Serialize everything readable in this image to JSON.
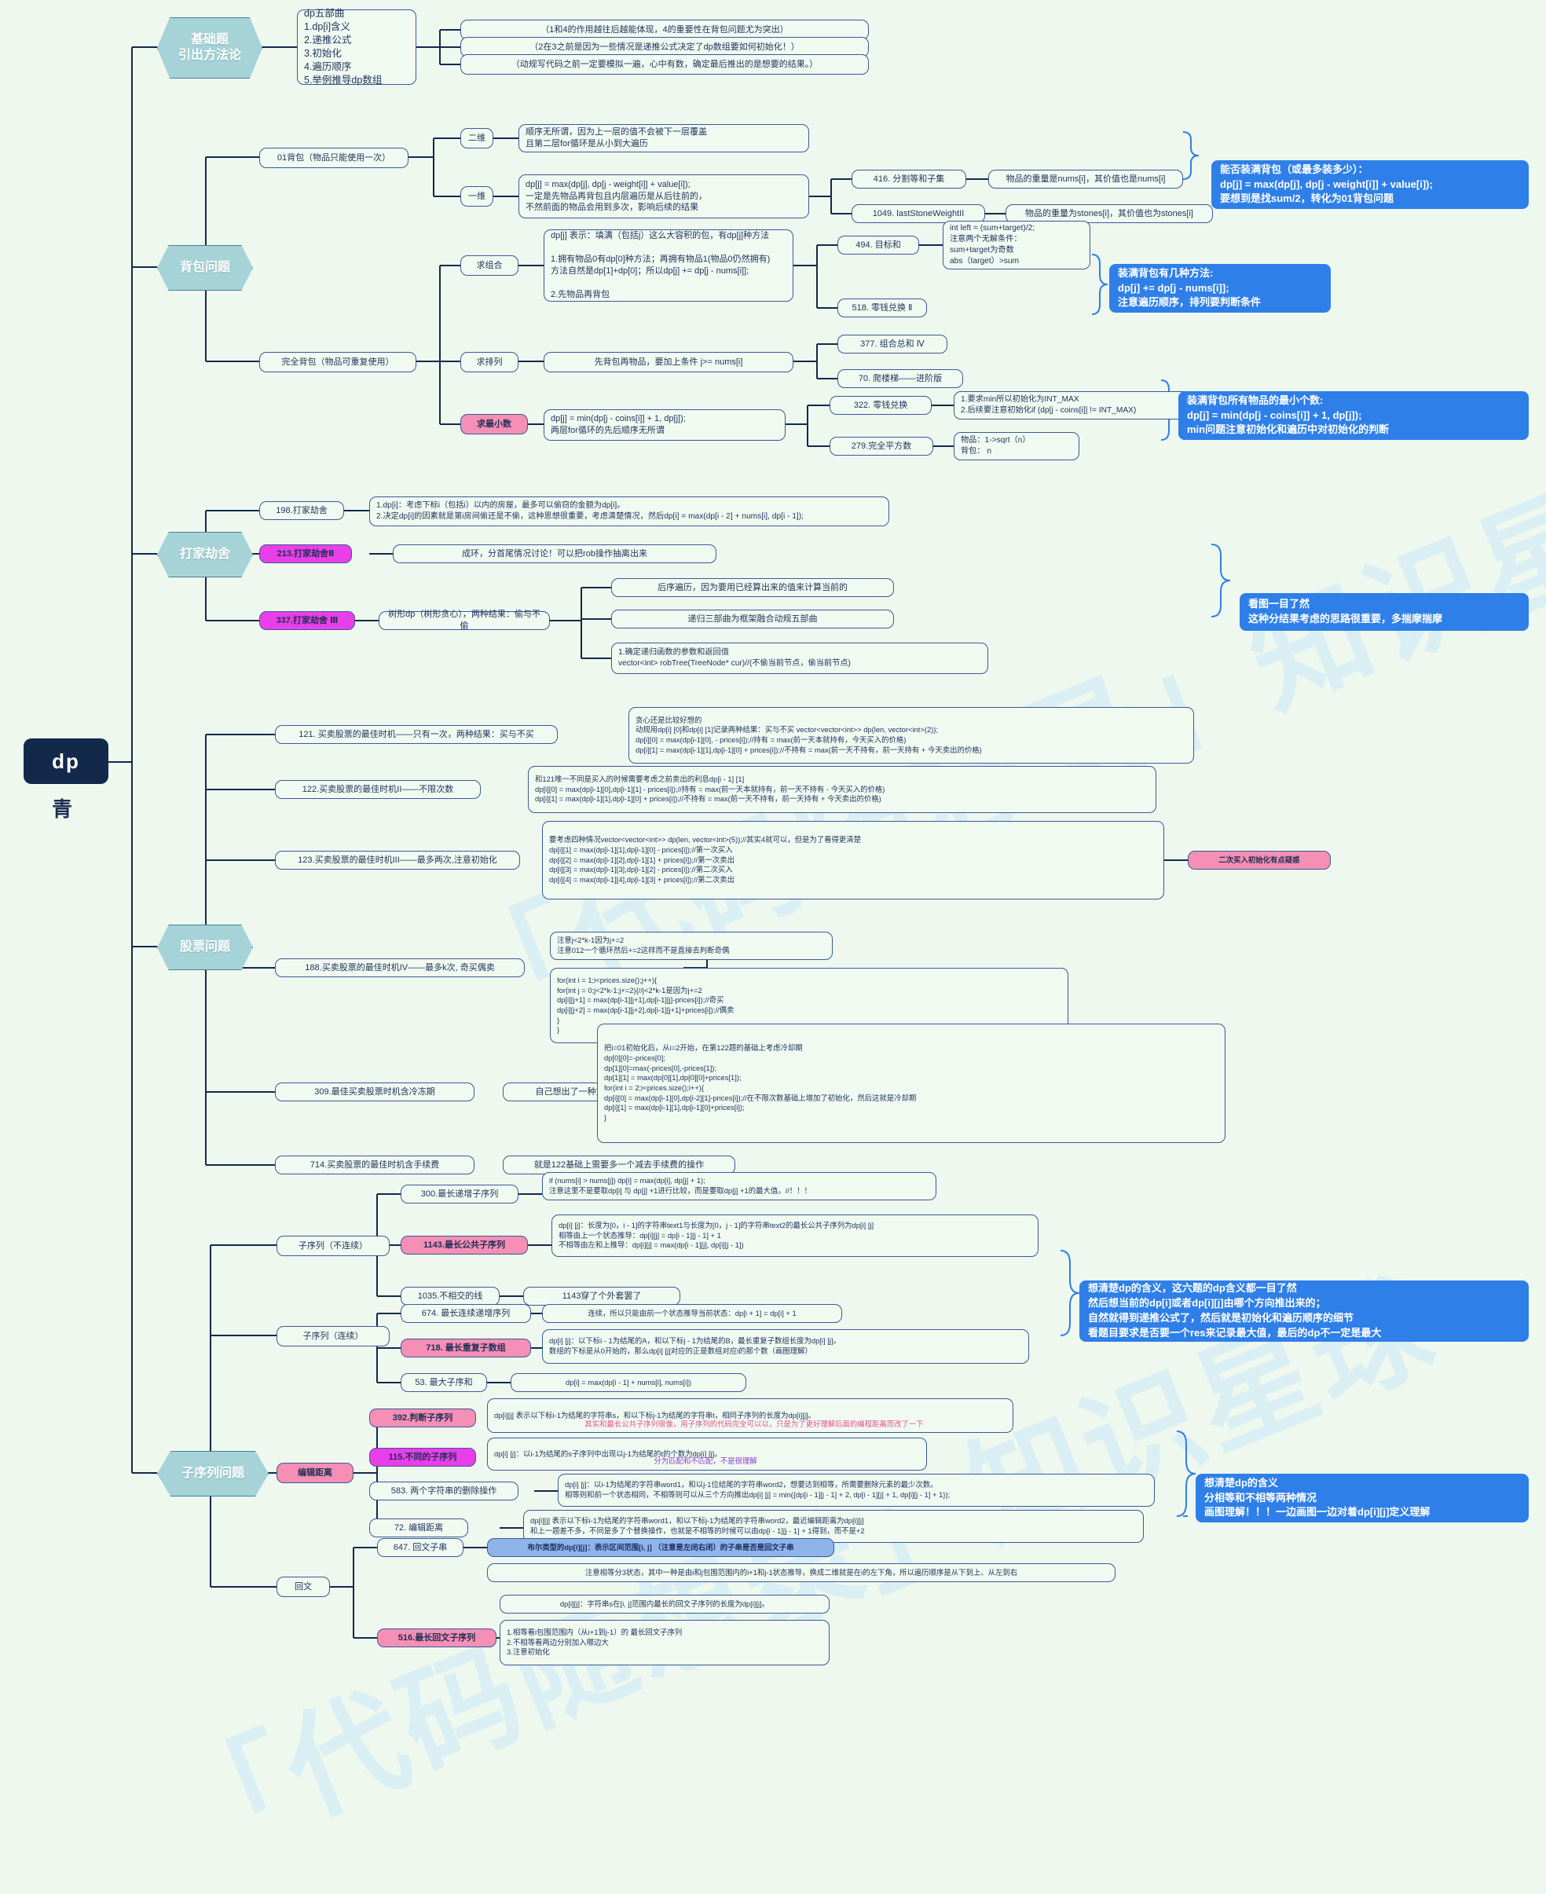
{
  "root": {
    "title": "dp",
    "sub": "青"
  },
  "watermarks": [
    "「代码随想录」知识星球",
    "「代码随想录」知识星球"
  ],
  "colors": {
    "background": "#eef8ee",
    "node_border": "#3b5998",
    "node_fill": "#f1faf1",
    "hex_fill": "#a5d3d8",
    "callout_blue": "#2f7fe8",
    "highlight_pink": "#f58fb5",
    "highlight_magenta": "#e83fe8",
    "root_fill": "#13294b"
  },
  "branches": {
    "basics": {
      "label": "基础题\n引出方法论"
    },
    "knapsack": {
      "label": "背包问题"
    },
    "robber": {
      "label": "打家劫舍"
    },
    "stock": {
      "label": "股票问题"
    },
    "subsequence": {
      "label": "子序列问题"
    }
  },
  "basics": {
    "five_steps": "dp五部曲\n1.dp[i]含义\n2.递推公式\n3.初始化\n4.遍历顺序\n5.举例推导dp数组",
    "note1": "（1和4的作用越往后越能体现，4的重要性在背包问题尤为突出）",
    "note2": "（2在3之前是因为一些情况是递推公式决定了dp数组要如何初始化！）",
    "note3": "（动规写代码之前一定要模拟一遍，心中有数，确定最后推出的是想要的结果。）"
  },
  "knapsack": {
    "k01": "01背包（物品只能使用一次）",
    "dim2_label": "二维",
    "dim2_text": "顺序无所谓，因为上一层的值不会被下一层覆盖\n且第二层for循环是从小到大遍历",
    "dim1_label": "一维",
    "dim1_text": "dp[j] = max(dp[j], dp[j - weight[i]] + value[i]);\n一定是先物品再背包且内层遍历是从后往前的，\n不然前面的物品会用到多次，影响后续的结果",
    "p416": "416. 分割等和子集",
    "p416_note": "物品的重量是nums[i]，其价值也是nums[i]",
    "p1049": "1049. lastStoneWeightII",
    "p1049_note": "物品的重量为stones[i]，其价值也为stones[i]",
    "callout1": "能否装满背包（或最多装多少）：\ndp[j] = max(dp[j], dp[j - weight[i]] + value[i]);\n要想到是找sum/2，转化为01背包问题",
    "complete": "完全背包（物品可重复使用）",
    "comb_label": "求组合",
    "comb_text": "dp[j] 表示：填满（包括j）这么大容积的包，有dp[j]种方法\n\n1.拥有物品0有dp[0]种方法；再拥有物品1(物品0仍然拥有)\n方法自然是dp[1]+dp[0]；所以dp[j] += dp[j - nums[i]];\n\n2.先物品再背包",
    "p494": "494. 目标和",
    "p494_note": "int left = (sum+target)/2;\n注意两个无解条件：\nsum+target为奇数\nabs（target）>sum",
    "p518": "518. 零钱兑换 Ⅱ",
    "callout2": "装满背包有几种方法:\ndp[j] += dp[j - nums[i]];\n注意遍历顺序，排列要判断条件",
    "perm_label": "求排列",
    "perm_text": "先背包再物品，要加上条件 j>= nums[i]",
    "p377": "377. 组合总和 Ⅳ",
    "p70": "70. 爬楼梯——进阶版",
    "min_label": "求最小数",
    "min_text": "dp[j] = min(dp[j - coins[i]] + 1, dp[j]);\n两层for循环的先后顺序无所谓",
    "p322": "322. 零钱兑换",
    "p322_note": "1.要求min所以初始化为INT_MAX\n2.后续要注意初始化if (dp[j - coins[i]] != INT_MAX)",
    "p279": "279.完全平方数",
    "p279_note": "物品：1->sqrt（n）\n背包： n",
    "callout3": "装满背包所有物品的最小个数:\ndp[j] = min(dp[j - coins[i]] + 1, dp[j]);\nmin问题注意初始化和遍历中对初始化的判断"
  },
  "robber": {
    "p198": "198.打家劫舍",
    "p198_note": "1.dp[i]：考虑下标i（包括i）以内的房屋，最多可以偷窃的金额为dp[i]。\n2.决定dp[i]的因素就是第i房间偷还是不偷，这种思想很重要，考虑清楚情况，然后dp[i] = max(dp[i - 2] + nums[i], dp[i - 1]);",
    "p213": "213.打家劫舍Ⅱ",
    "p213_note": "成环，分首尾情况讨论！可以把rob操作抽离出来",
    "p337": "337.打家劫舍 Ⅲ",
    "p337_note": "树形dp（树形贪心），两种结果：偷与不偷",
    "n1": "后序遍历，因为要用已经算出来的值来计算当前的",
    "n2": "递归三部曲为框架融合动规五部曲",
    "n3": "1.确定递归函数的参数和返回值\nvector<int> robTree(TreeNode* cur)//(不偷当前节点，偷当前节点)",
    "callout": "看图一目了然\n这种分结果考虑的思路很重要，多揣摩揣摩"
  },
  "stock": {
    "p121": "121. 买卖股票的最佳时机——只有一次，两种结果：买与不买",
    "p121_note": "贪心还是比较好想的\n动规用dp[i] [0]和dp[i] [1]记录两种结果：买与不买 vector<vector<int>> dp(len, vector<int>(2));\ndp[i][0] = max(dp[i-1][0], - prices[i]);//持有 = max(前一天本就持有，今天买入的价格)\ndp[i][1] = max(dp[i-1][1],dp[i-1][0] + prices[i]);//不持有 = max(前一天不持有，前一天持有 + 今天卖出的价格)",
    "p122": "122.买卖股票的最佳时机II——不限次数",
    "p122_note": "和121唯一不同是买入的时候需要考虑之前卖出的利息dp[i - 1] [1]\ndp[i][0] = max(dp[i-1][0],dp[i-1][1] - prices[i]);//持有 = max(前一天本就持有，前一天不持有 - 今天买入的价格)\ndp[i][1] = max(dp[i-1][1],dp[i-1][0] + prices[i]);//不持有 = max(前一天不持有，前一天持有 + 今天卖出的价格)",
    "p123": "123.买卖股票的最佳时机III——最多两次,注意初始化",
    "p123_note": "要考虑四种情况vector<vector<int>> dp(len, vector<int>(5));//其实4就可以，但是为了看得更清楚\ndp[i][1] = max(dp[i-1][1],dp[i-1][0] - prices[i]);//第一次买入\ndp[i][2] = max(dp[i-1][2],dp[i-1][1] + prices[i]);//第一次卖出\ndp[i][3] = max(dp[i-1][3],dp[i-1][2] - prices[i]);//第二次买入\ndp[i][4] = max(dp[i-1][4],dp[i-1][3] + prices[i]);//第二次卖出",
    "p123_tag": "二次买入初始化有点疑惑",
    "p188": "188.买卖股票的最佳时机IV——最多k次, 奇买偶卖",
    "p188_note1": "注意j<2*k-1因为j+=2\n注意012一个循环然后+=2这样而不是直接去判断奇偶",
    "p188_note2": "for(int i = 1;i<prices.size();j++){\n       for(int j = 0;j<2*k-1;j+=2){//j<2*k-1是因为j+=2\n         dp[i][j+1] = max(dp[i-1][j+1],dp[i-1][j]-prices[i]);//奇买\n         dp[i][j+2] = max(dp[i-1][j+2],dp[i-1][j+1]+prices[i]);//偶卖\n       }\n    }",
    "p309": "309.最佳买卖股票时机含冷冻期",
    "p309_label": "自己想出了一种方法",
    "p309_note": "把i=01初始化后，从i=2开始，在第122题的基础上考虑冷却期\n    dp[0][0]=-prices[0];\n    dp[1][0]=max(-prices[0],-prices[1]);\n    dp[1][1] = max(dp[0][1],dp[0][0]+prices[1]);\n    for(int i = 2;i<prices.size();i++){\n       dp[i][0] = max(dp[i-1][0],dp[i-2][1]-prices[i]);//在不限次数基础上增加了初始化，然后这就是冷却期\n       dp[i][1] = max(dp[i-1][1],dp[i-1][0]+prices[i]);\n    }",
    "p714": "714.买卖股票的最佳时机含手续费",
    "p714_note": "就是122基础上需要多一个减去手续费的操作"
  },
  "subsequence": {
    "sub_discont": "子序列（不连续）",
    "p300": "300.最长递增子序列",
    "p300_note": "if (nums[i] > nums[j]) dp[i] = max(dp[i], dp[j] + 1);\n注意这里不是要取dp[i] 与 dp[j] +1进行比较，而是要取dp[j] +1的最大值。//！！！",
    "p1143": "1143.最长公共子序列",
    "p1143_note": "dp[i] [j]：长度为[0，i - 1]的字符串text1与长度为[0，j - 1]的字符串text2的最长公共子序列为dp[i] [j]\n相等由上一个状态推导：dp[i][j] = dp[i - 1][j - 1] + 1\n不相等由左和上推导：dp[i][j] = max(dp[i - 1][j], dp[i][j - 1])",
    "p1035": "1035.不相交的线",
    "p1035_note": "1143穿了个外套罢了",
    "sub_cont": "子序列（连续）",
    "p674": "674. 最长连续递增序列",
    "p674_note": "连续，所以只能由前一个状态推导当前状态：dp[i + 1] = dp[i] + 1",
    "p718": "718. 最长重复子数组",
    "p718_note": "dp[i] [j]：以下标i - 1为结尾的A，和以下标j - 1为结尾的B，最长重复子数组长度为dp[i] [j]。\n数组的下标是从0开始的，那么dp[i] [j]对应的正是数组对应i的那个数（画图理解）",
    "p53": "53. 最大子序和",
    "p53_note": "dp[i] = max(dp[i - 1] + nums[i], nums[i])",
    "callout_top": "想清楚dp的含义，这六题的dp含义都一目了然\n然后想当前的dp[i]或者dp[i][j]由哪个方向推出来的；\n自然就得到递推公式了，然后就是初始化和遍历顺序的细节\n看题目要求是否要一个res来记录最大值，最后的dp不一定是最大",
    "edit": "编辑距离",
    "p392": "392.判断子序列",
    "p392_note": "dp[i][j] 表示以下标i-1为结尾的字符串s，和以下标j-1为结尾的字符串t，相同子序列的长度为dp[i][j]。",
    "p392_note2": "其实和最长公共子序列很像，用子序列的代码完全可以以，只是为了更好理解后面的编程距离而改了一下",
    "p115": "115.不同的子序列",
    "p115_note": "dp[i] [j]：以i-1为结尾的s子序列中出现以j-1为结尾的t的个数为dp[i] [j]。",
    "p115_note2": "分为匹配和不匹配，不是很理解",
    "p583": "583. 两个字符串的删除操作",
    "p583_note": "dp[i] [j]：以i-1为结尾的字符串word1，和以j-1位结尾的字符串word2，想要达到相等，所需要删除元素的最少次数。\n相等则和前一个状态相同，不相等则可以从三个方向推出dp[i] [j] = min({dp[i - 1][j - 1] + 2, dp[i - 1][j] + 1, dp[i][j - 1] + 1});",
    "p72": "72. 编辑距离",
    "p72_note": "dp[i][j] 表示以下标i-1为结尾的字符串word1，和以下标j-1为结尾的字符串word2，最近编辑距离为dp[i][j]\n和上一题差不多，不同是多了个替换操作，也就是不相等的时候可以由dp[i - 1][j - 1] + 1得到，而不是+2",
    "palindrome": "回文",
    "p647": "647. 回文子串",
    "p647_note_hl": "布尔类型的dp[i][j]：表示区间范围[i, j] （注意是左闭右闭）的子串是否是回文子串",
    "p647_note": "注意相等分3状态，其中一种是由i和j包围范围内的i+1和j-1状态推导，换成二维就是在i的左下角，所以遍历顺序是从下到上、从左到右",
    "p516": "516.最长回文子序列",
    "p516_note": "dp[i][j]：字符串s在[i, j]范围内最长的回文子序列的长度为dp[i][j]。",
    "p516_note2": "1.相等看i包围范围内（从i+1到j-1）的 最长回文子序列\n2.不相等看两边分别加入哪边大\n3.注意初始化",
    "callout_bottom": "想清楚dp的含义\n分相等和不相等两种情况\n画图理解！！！一边画图一边对着dp[i][j]定义理解"
  }
}
